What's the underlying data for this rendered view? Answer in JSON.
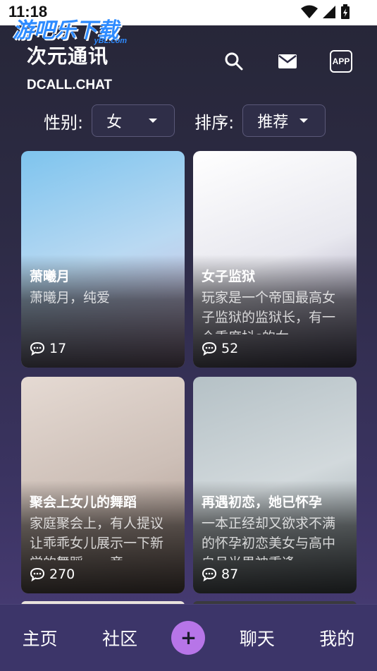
{
  "status": {
    "time": "11:18"
  },
  "watermark": {
    "text": "游吧乐下载",
    "sub": "yBL.com"
  },
  "header": {
    "title": "次元通讯",
    "domain": "DCALL.CHAT",
    "app_label": "APP"
  },
  "filters": {
    "gender_label": "性别:",
    "gender_value": "女",
    "sort_label": "排序:",
    "sort_value": "推荐"
  },
  "cards": [
    {
      "name": "萧曦月",
      "desc": "萧曦月，纯爱",
      "count": "17",
      "colors": [
        "#7ec4ee",
        "#b9d9f2",
        "#d7b5d9"
      ]
    },
    {
      "name": "女子监狱",
      "desc": "玩家是一个帝国最高女子监狱的监狱长，有一个重度抖s的女",
      "count": "52",
      "colors": [
        "#ffffff",
        "#e8e8ef",
        "#8f88a8"
      ]
    },
    {
      "name": "聚会上女儿的舞蹈",
      "desc": "家庭聚会上，有人提议让乖乖女儿展示一下新学的舞蹈，一旁",
      "count": "270",
      "colors": [
        "#e5dad3",
        "#cdbfb7",
        "#a89186"
      ]
    },
    {
      "name": "再遇初恋，她已怀孕",
      "desc": "一本正经却又欲求不满的怀孕初恋美女与高中白月光男神重逢",
      "count": "87",
      "colors": [
        "#b5c1c6",
        "#d2d9dc",
        "#8b979c"
      ]
    }
  ],
  "nav": {
    "home": "主页",
    "community": "社区",
    "plus": "+",
    "chat": "聊天",
    "mine": "我的"
  },
  "icons": {
    "search": "search-icon",
    "mail": "mail-icon",
    "comment": "comment-icon",
    "wifi": "wifi-icon",
    "signal": "signal-icon",
    "battery": "battery-icon"
  }
}
